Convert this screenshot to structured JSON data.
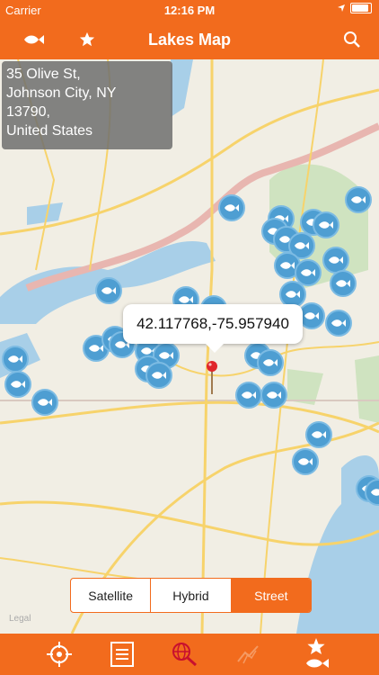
{
  "status": {
    "carrier": "Carrier",
    "time": "12:16 PM"
  },
  "nav": {
    "title": "Lakes Map"
  },
  "address": {
    "lines": [
      "35 Olive St,",
      "Johnson City, NY",
      "13790,",
      "United States"
    ]
  },
  "callout": {
    "coords": "42.117768,-75.957940"
  },
  "map_type": {
    "options": [
      "Satellite",
      "Hybrid",
      "Street"
    ],
    "selected": "Street"
  },
  "legal": "Legal",
  "colors": {
    "accent": "#f26b1d",
    "pin": "#4e9ed2",
    "water": "#a8cfe8"
  }
}
